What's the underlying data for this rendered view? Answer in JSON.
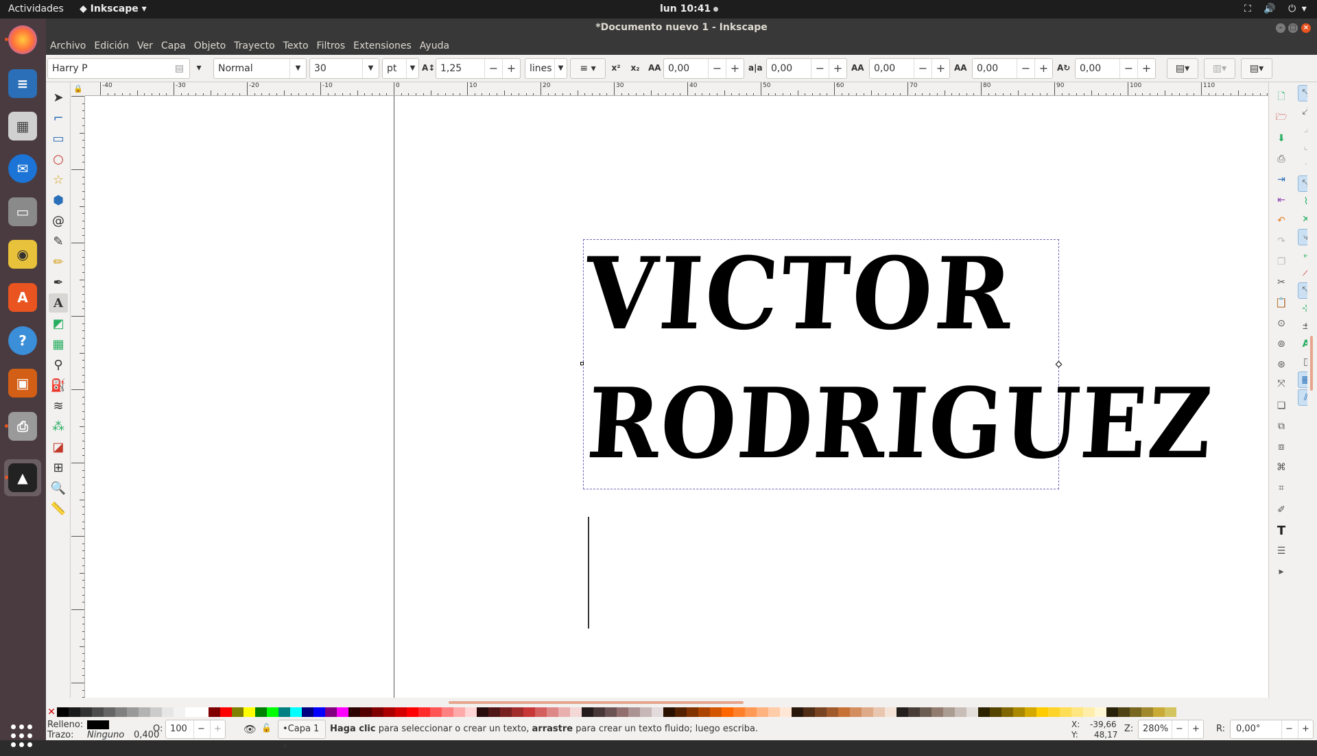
{
  "topbar": {
    "activities": "Actividades",
    "app_menu": "Inkscape",
    "clock": "lun 10:41"
  },
  "window": {
    "title": "*Documento nuevo 1 - Inkscape"
  },
  "menu": {
    "items": [
      "Archivo",
      "Edición",
      "Ver",
      "Capa",
      "Objeto",
      "Trayecto",
      "Texto",
      "Filtros",
      "Extensiones",
      "Ayuda"
    ]
  },
  "toolctrl": {
    "font_family": "Harry P",
    "font_style": "Normal",
    "font_size": "30",
    "unit": "pt",
    "line_spacing": "1,25",
    "line_unit": "lines",
    "letter_spacing": "0,00",
    "word_spacing": "0,00",
    "kern_h": "0,00",
    "kern_v": "0,00",
    "rotation": "0,00"
  },
  "ruler": {
    "top_labels": [
      "-40",
      "-30",
      "-20",
      "-10",
      "0",
      "10",
      "20",
      "30",
      "40",
      "50",
      "60",
      "70",
      "80",
      "90",
      "100",
      "110"
    ]
  },
  "canvas": {
    "line1": "VICTOR",
    "line2": "RODRIGUEZ"
  },
  "palette": {
    "colors": [
      "#000000",
      "#1a1a1a",
      "#333333",
      "#4d4d4d",
      "#666666",
      "#808080",
      "#999999",
      "#b3b3b3",
      "#cccccc",
      "#e6e6e6",
      "#f2f2f2",
      "#ffffff",
      "#ffffff",
      "#800000",
      "#ff0000",
      "#808000",
      "#ffff00",
      "#008000",
      "#00ff00",
      "#008080",
      "#00ffff",
      "#000080",
      "#0000ff",
      "#800080",
      "#ff00ff",
      "#2b0000",
      "#550000",
      "#800000",
      "#aa0000",
      "#d40000",
      "#ff0000",
      "#ff2a2a",
      "#ff5555",
      "#ff8080",
      "#ffaaaa",
      "#ffd5d5",
      "#280b0b",
      "#501616",
      "#782121",
      "#a02c2c",
      "#c83737",
      "#d35f5f",
      "#de8787",
      "#e9afaf",
      "#f4d7d7",
      "#241c1c",
      "#483737",
      "#6c5353",
      "#916f6f",
      "#ac9393",
      "#c8b7b7",
      "#e3dbdb",
      "#2b1100",
      "#552200",
      "#803300",
      "#aa4400",
      "#d45500",
      "#ff6600",
      "#ff7f2a",
      "#ff9955",
      "#ffb380",
      "#ffccaa",
      "#ffe6d5",
      "#28170b",
      "#502d16",
      "#784421",
      "#a05a2c",
      "#c87137",
      "#d38d5f",
      "#deaa87",
      "#e9c6af",
      "#f4e3d7",
      "#241f1c",
      "#483e37",
      "#6c5d53",
      "#917c6f",
      "#ac9d93",
      "#c8beb7",
      "#e3dedb",
      "#2b2200",
      "#554400",
      "#806600",
      "#aa8800",
      "#d4aa00",
      "#ffcc00",
      "#ffd42a",
      "#ffdd55",
      "#ffe680",
      "#ffeeaa",
      "#fff6d5",
      "#28220b",
      "#504416",
      "#786721",
      "#a0892c",
      "#c8ab37",
      "#d4c45f"
    ]
  },
  "status": {
    "fill_label": "Relleno:",
    "stroke_label": "Trazo:",
    "stroke_value": "Ninguno",
    "stroke_width": "0,400",
    "opacity_label": "O:",
    "opacity_value": "100",
    "layer": "•Capa 1",
    "message_b1": "Haga clic",
    "message_t1": " para seleccionar o crear un texto, ",
    "message_b2": "arrastre",
    "message_t2": " para crear un texto fluido; luego escriba.",
    "x_label": "X:",
    "x_value": "-39,66",
    "y_label": "Y:",
    "y_value": "48,17",
    "zoom_label": "Z:",
    "zoom_value": "280%",
    "rot_label": "R:",
    "rot_value": "0,00°"
  }
}
